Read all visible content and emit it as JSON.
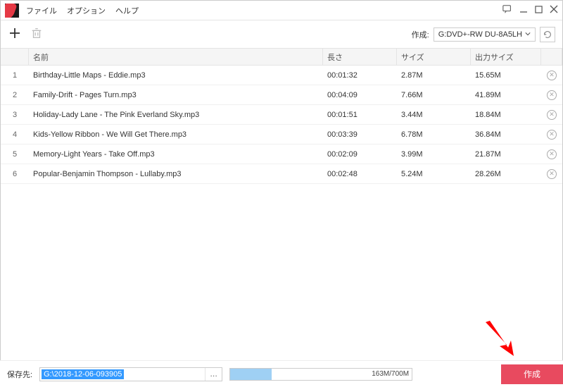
{
  "menu": {
    "file": "ファイル",
    "option": "オプション",
    "help": "ヘルプ"
  },
  "toolbar": {
    "create_label": "作成:",
    "drive": "G:DVD+-RW DU-8A5LH"
  },
  "headers": {
    "name": "名前",
    "duration": "長さ",
    "size": "サイズ",
    "out_size": "出力サイズ"
  },
  "rows": [
    {
      "idx": "1",
      "name": "Birthday-Little Maps - Eddie.mp3",
      "dur": "00:01:32",
      "size": "2.87M",
      "out": "15.65M"
    },
    {
      "idx": "2",
      "name": "Family-Drift - Pages Turn.mp3",
      "dur": "00:04:09",
      "size": "7.66M",
      "out": "41.89M"
    },
    {
      "idx": "3",
      "name": "Holiday-Lady Lane - The Pink Everland Sky.mp3",
      "dur": "00:01:51",
      "size": "3.44M",
      "out": "18.84M"
    },
    {
      "idx": "4",
      "name": "Kids-Yellow Ribbon - We Will Get There.mp3",
      "dur": "00:03:39",
      "size": "6.78M",
      "out": "36.84M"
    },
    {
      "idx": "5",
      "name": "Memory-Light Years - Take Off.mp3",
      "dur": "00:02:09",
      "size": "3.99M",
      "out": "21.87M"
    },
    {
      "idx": "6",
      "name": "Popular-Benjamin Thompson - Lullaby.mp3",
      "dur": "00:02:48",
      "size": "5.24M",
      "out": "28.26M"
    }
  ],
  "footer": {
    "save_label": "保存先:",
    "path": "G:\\2018-12-06-093905",
    "progress_text": "163M/700M",
    "create_button": "作成"
  }
}
